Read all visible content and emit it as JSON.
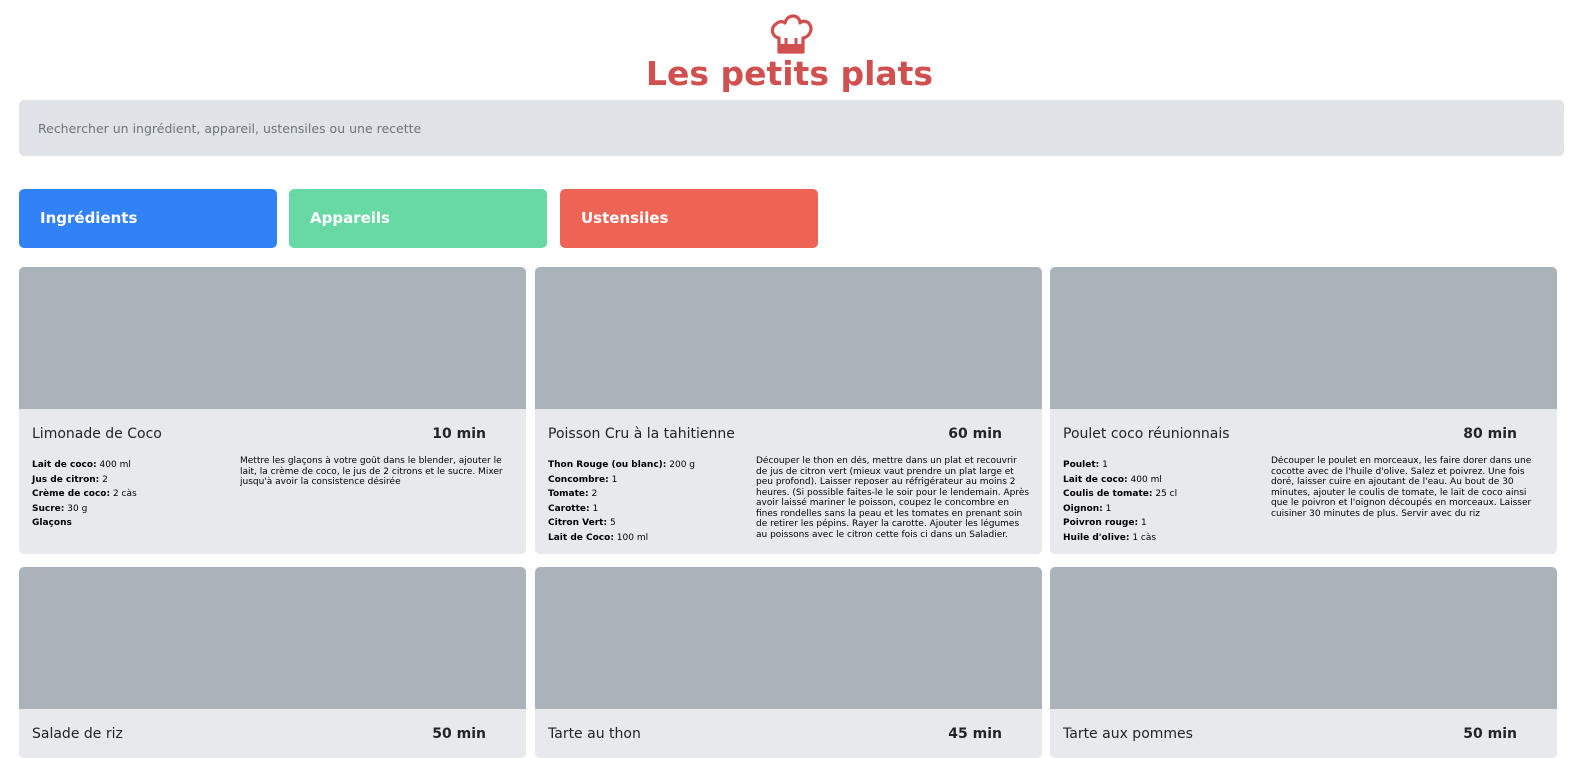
{
  "header": {
    "logo_icon": "chef-hat-icon",
    "title": "Les petits plats"
  },
  "search": {
    "placeholder": "Rechercher un ingrédient, appareil, ustensiles ou une recette",
    "value": ""
  },
  "filters": [
    {
      "label": "Ingrédients",
      "color": "#3282f7"
    },
    {
      "label": "Appareils",
      "color": "#68d9a4"
    },
    {
      "label": "Ustensiles",
      "color": "#ed6454"
    }
  ],
  "recipes": [
    {
      "name": "Limonade de Coco",
      "time": "10 min",
      "ingredients": [
        {
          "name": "Lait de coco:",
          "qty": "400 ml"
        },
        {
          "name": "Jus de citron:",
          "qty": "2"
        },
        {
          "name": "Crème de coco:",
          "qty": "2 càs"
        },
        {
          "name": "Sucre:",
          "qty": "30 g"
        },
        {
          "name": "Glaçons",
          "qty": ""
        }
      ],
      "description": "Mettre les glaçons à votre goût dans le blender, ajouter le lait, la crème de coco, le jus de 2 citrons et le sucre. Mixer jusqu'à avoir la consistence désirée"
    },
    {
      "name": "Poisson Cru à la tahitienne",
      "time": "60 min",
      "ingredients": [
        {
          "name": "Thon Rouge (ou blanc):",
          "qty": "200 g"
        },
        {
          "name": "Concombre:",
          "qty": "1"
        },
        {
          "name": "Tomate:",
          "qty": "2"
        },
        {
          "name": "Carotte:",
          "qty": "1"
        },
        {
          "name": "Citron Vert:",
          "qty": "5"
        },
        {
          "name": "Lait de Coco:",
          "qty": "100 ml"
        }
      ],
      "description": "Découper le thon en dés, mettre dans un plat et recouvrir de jus de citron vert (mieux vaut prendre un plat large et peu profond). Laisser reposer au réfrigérateur au moins 2 heures. (Si possible faites-le le soir pour le lendemain. Après avoir laissé mariner le poisson, coupez le concombre en fines rondelles sans la peau et les tomates en prenant soin de retirer les pépins. Rayer la carotte. Ajouter les légumes au poissons avec le citron cette fois ci dans un Saladier. Ajouter …"
    },
    {
      "name": "Poulet coco réunionnais",
      "time": "80 min",
      "ingredients": [
        {
          "name": "Poulet:",
          "qty": "1"
        },
        {
          "name": "Lait de coco:",
          "qty": "400 ml"
        },
        {
          "name": "Coulis de tomate:",
          "qty": "25 cl"
        },
        {
          "name": "Oignon:",
          "qty": "1"
        },
        {
          "name": "Poivron rouge:",
          "qty": "1"
        },
        {
          "name": "Huile d'olive:",
          "qty": "1 càs"
        }
      ],
      "description": "Découper le poulet en morceaux, les faire dorer dans une cocotte avec de l'huile d'olive. Salez et poivrez. Une fois doré, laisser cuire en ajoutant de l'eau. Au bout de 30 minutes, ajouter le coulis de tomate, le lait de coco ainsi que le poivron et l'oignon découpés en morceaux. Laisser cuisiner 30 minutes de plus. Servir avec du riz"
    },
    {
      "name": "Salade de riz",
      "time": "50 min",
      "ingredients": [],
      "description": ""
    },
    {
      "name": "Tarte au thon",
      "time": "45 min",
      "ingredients": [],
      "description": ""
    },
    {
      "name": "Tarte aux pommes",
      "time": "50 min",
      "ingredients": [],
      "description": ""
    }
  ]
}
